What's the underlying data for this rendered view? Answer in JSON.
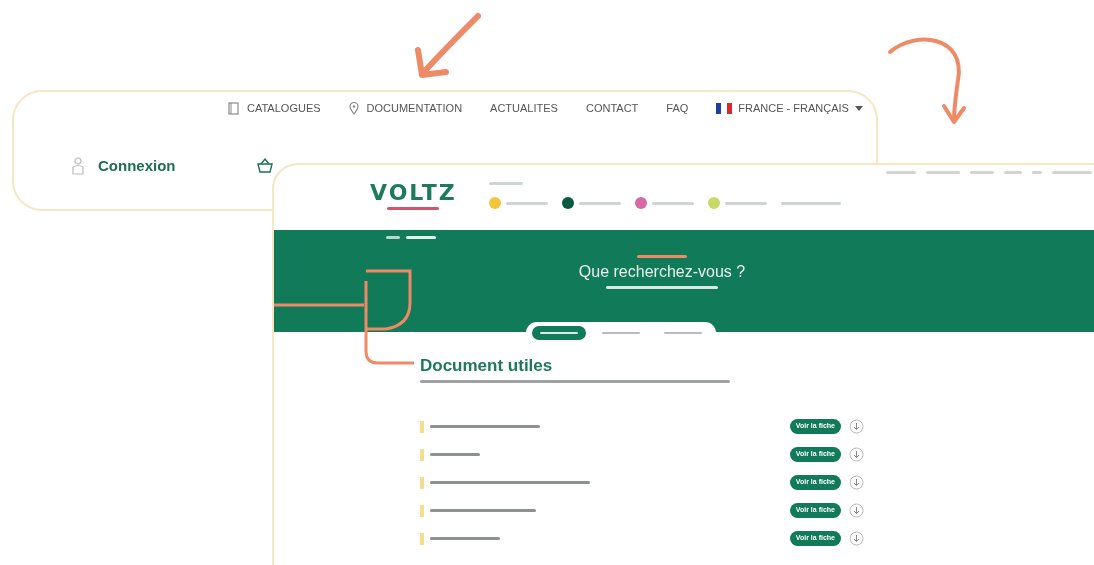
{
  "callout": {
    "nav": [
      {
        "label": "CATALOGUES"
      },
      {
        "label": "DOCUMENTATION"
      },
      {
        "label": "ACTUALITES"
      },
      {
        "label": "CONTACT"
      },
      {
        "label": "FAQ"
      }
    ],
    "language": "FRANCE - FRANÇAIS",
    "login": "Connexion"
  },
  "site": {
    "logo": "VOLTZ",
    "categories": [
      {
        "color": "#f2c53d"
      },
      {
        "color": "#0b5a3f"
      },
      {
        "color": "#d66aa8"
      },
      {
        "color": "#c9d86a"
      }
    ],
    "hero": {
      "title": "Que recherchez-vous ?"
    },
    "tabs": [
      {
        "selected": true
      },
      {
        "selected": false
      },
      {
        "selected": false
      }
    ],
    "section": {
      "title": "Document utiles",
      "documents": [
        {
          "button": "Voir la fiche"
        },
        {
          "button": "Voir la fiche"
        },
        {
          "button": "Voir la fiche"
        },
        {
          "button": "Voir la fiche"
        },
        {
          "button": "Voir la fiche"
        }
      ]
    }
  }
}
